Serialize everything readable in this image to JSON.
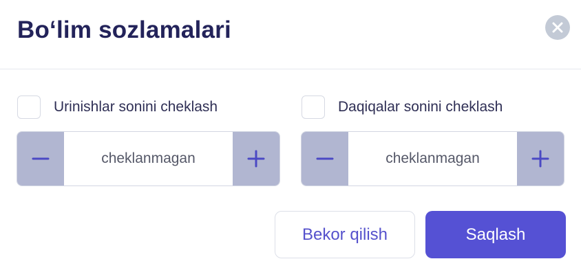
{
  "dialog": {
    "title": "Bo‘lim sozlamalari",
    "close_icon": "close-icon"
  },
  "attempts": {
    "checkbox_label": "Urinishlar sonini cheklash",
    "checked": false,
    "value": "cheklanmagan"
  },
  "minutes": {
    "checkbox_label": "Daqiqalar sonini cheklash",
    "checked": false,
    "value": "cheklanmagan"
  },
  "actions": {
    "cancel_label": "Bekor qilish",
    "save_label": "Saqlash"
  },
  "colors": {
    "title": "#23235a",
    "accent": "#5551d4",
    "stepper_button": "#b1b6d1",
    "close_button": "#c3cad6"
  }
}
